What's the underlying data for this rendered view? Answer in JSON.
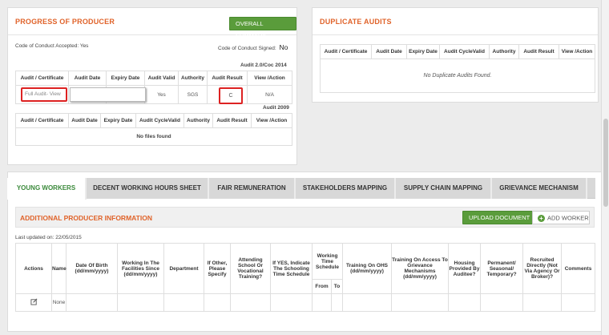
{
  "progress": {
    "title": "PROGRESS OF PRODUCER",
    "overall_summary_label": "OVERALL SUMMARY",
    "coc_accepted": "Code of Conduct Accepted: Yes",
    "coc_signed_label": "Code of Conduct Signed:",
    "coc_signed_value": "No",
    "audit1_caption": "Audit 2.0/Coc 2014",
    "audit1_headers": [
      "Audit / Certificate",
      "Audit Date",
      "Expiry Date",
      "Audit Valid",
      "Authority",
      "Audit Result",
      "View /Action"
    ],
    "audit1_row": {
      "certificate": "Full Audit- View",
      "audit_date": "",
      "expiry_date": "",
      "valid": "Yes",
      "authority": "SGS",
      "result": "C",
      "action": "N/A"
    },
    "audit2_caption": "Audit 2009",
    "audit2_headers": [
      "Audit / Certificate",
      "Audit Date",
      "Expiry Date",
      "Audit CycleValid",
      "Authority",
      "Audit Result",
      "View /Action"
    ],
    "audit2_empty": "No files found"
  },
  "duplicate": {
    "title": "DUPLICATE AUDITS",
    "headers": [
      "Audit / Certificate",
      "Audit Date",
      "Expiry Date",
      "Audit CycleValid",
      "Authority",
      "Audit Result",
      "View /Action"
    ],
    "empty": "No Duplicate Audits Found."
  },
  "tabs": [
    "YOUNG WORKERS",
    "DECENT WORKING HOURS SHEET",
    "FAIR REMUNERATION",
    "STAKEHOLDERS MAPPING",
    "SUPPLY CHAIN MAPPING",
    "GRIEVANCE MECHANISM"
  ],
  "additional": {
    "title": "ADDITIONAL PRODUCER INFORMATION",
    "upload_label": "UPLOAD DOCUMENT",
    "add_worker_label": "ADD WORKER",
    "last_updated": "Last updated on: 22/05/2015",
    "headers": {
      "actions": "Actions",
      "name": "Name",
      "dob": "Date Of Birth (dd/mm/yyyy)",
      "working_since": "Working In The Facilities Since (dd/mm/yyyy)",
      "department": "Department",
      "if_other": "If Other, Please Specify",
      "attending": "Attending School Or Vocational Training?",
      "if_yes": "If YES, Indicate The Schooling Time Schedule",
      "working_time": "Working Time Schedule",
      "from": "From",
      "to": "To",
      "training_ohs": "Training On OHS (dd/mm/yyyy)",
      "training_grievance": "Training On Access To Grievance Mechanisms (dd/mm/yyyy)",
      "housing": "Housing Provided By Auditee?",
      "permanent": "Permanent/ Seasonal/ Temporary?",
      "recruited": "Recruited Directly (Not Via Agency Or Broker)?",
      "comments": "Comments"
    },
    "row": {
      "name": "None"
    }
  },
  "colors": {
    "accent_orange": "#e0632a",
    "accent_green": "#5a9c3b",
    "highlight_red": "#d22"
  }
}
